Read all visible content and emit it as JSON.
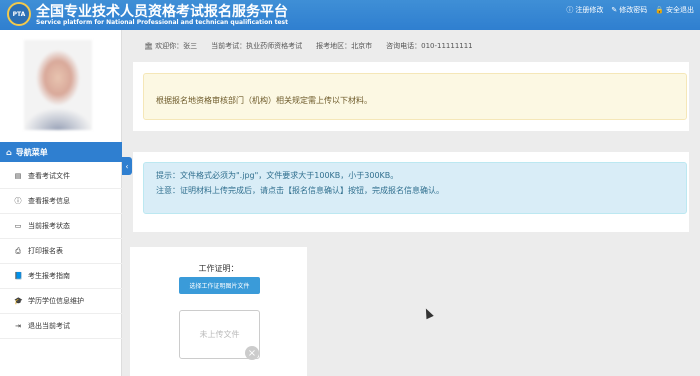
{
  "header": {
    "logo_text": "PTA",
    "title": "全国专业技术人员资格考试报名服务平台",
    "subtitle": "Service platform for National Professional and technican qualification test",
    "links": [
      {
        "icon": "info-circle-icon",
        "glyph": "ⓘ",
        "label": "注册修改"
      },
      {
        "icon": "edit-icon",
        "glyph": "✎",
        "label": "修改密码"
      },
      {
        "icon": "lock-icon",
        "glyph": "🔒",
        "label": "安全退出"
      }
    ]
  },
  "info_bar": {
    "welcome": "欢迎你：张三",
    "exam": "当前考试：执业药师资格考试",
    "region": "报考地区：北京市",
    "phone": "咨询电话：010-11111111"
  },
  "sidebar": {
    "nav_header": "导航菜单",
    "items": [
      {
        "icon": "doc-icon",
        "glyph": "▤",
        "label": "查看考试文件"
      },
      {
        "icon": "info-icon",
        "glyph": "ⓘ",
        "label": "查看报考信息"
      },
      {
        "icon": "monitor-icon",
        "glyph": "▭",
        "label": "当前报考状态"
      },
      {
        "icon": "print-icon",
        "glyph": "⎙",
        "label": "打印报名表"
      },
      {
        "icon": "book-icon",
        "glyph": "📘",
        "label": "考生报考指南"
      },
      {
        "icon": "graduation-icon",
        "glyph": "🎓",
        "label": "学历学位信息维护"
      },
      {
        "icon": "exit-icon",
        "glyph": "⇥",
        "label": "退出当前考试"
      }
    ]
  },
  "main": {
    "warning": "根据报名地资格审核部门（机构）相关规定需上传以下材料。",
    "notice_line1": "提示：文件格式必须为\".jpg\"，文件要求大于100KB，小于300KB。",
    "notice_line2": "注意：证明材料上传完成后，请点击【报名信息确认】按钮，完成报名信息确认。",
    "upload": {
      "label": "工作证明：",
      "button": "选择工作证明图片文件",
      "placeholder": "未上传文件"
    }
  },
  "colors": {
    "primary": "#2f7fd0",
    "warning_bg": "#fcf8e3",
    "info_bg": "#d9edf7"
  }
}
